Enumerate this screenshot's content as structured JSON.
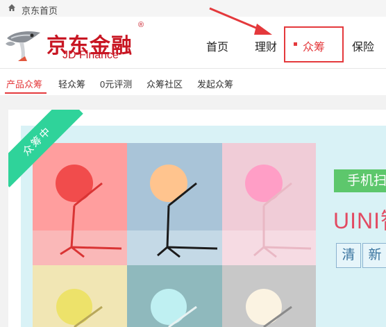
{
  "topbar": {
    "home_link": "京东首页",
    "home_icon": "home-icon"
  },
  "logo": {
    "name_cn": "京东金融",
    "name_en": "JD Finance",
    "reg_mark": "®",
    "icon": "rocket-mascot-icon"
  },
  "nav": {
    "items": [
      "首页",
      "理财",
      "众筹",
      "保险"
    ],
    "active_index": 2,
    "accent": "#e4393c"
  },
  "subnav": {
    "items": [
      "产品众筹",
      "轻众筹",
      "0元评测",
      "众筹社区",
      "发起众筹"
    ],
    "active_index": 0
  },
  "banner": {
    "ribbon": "众筹中",
    "promo_label": "手机扫",
    "title": "UINI智",
    "tags": [
      "清",
      "新"
    ],
    "ribbon_color": "#2fd39a",
    "promo_color": "#5dc76c",
    "title_color": "#e24a62"
  }
}
